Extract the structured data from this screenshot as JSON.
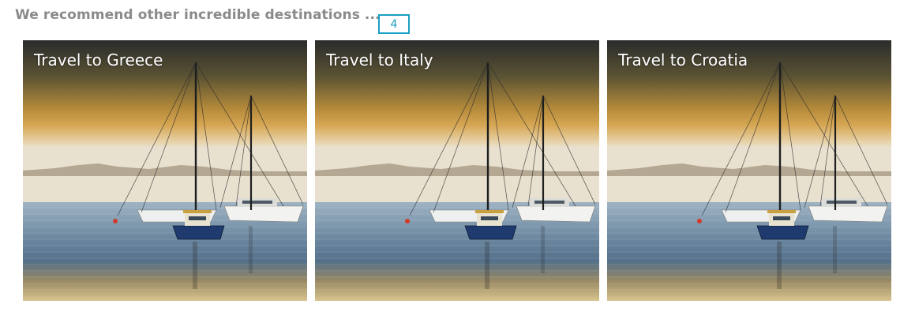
{
  "section": {
    "heading": "We recommend other incredible destinations ...",
    "badge": "4"
  },
  "destinations": [
    {
      "label": "Travel to Greece"
    },
    {
      "label": "Travel to Italy"
    },
    {
      "label": "Travel to Croatia"
    }
  ]
}
